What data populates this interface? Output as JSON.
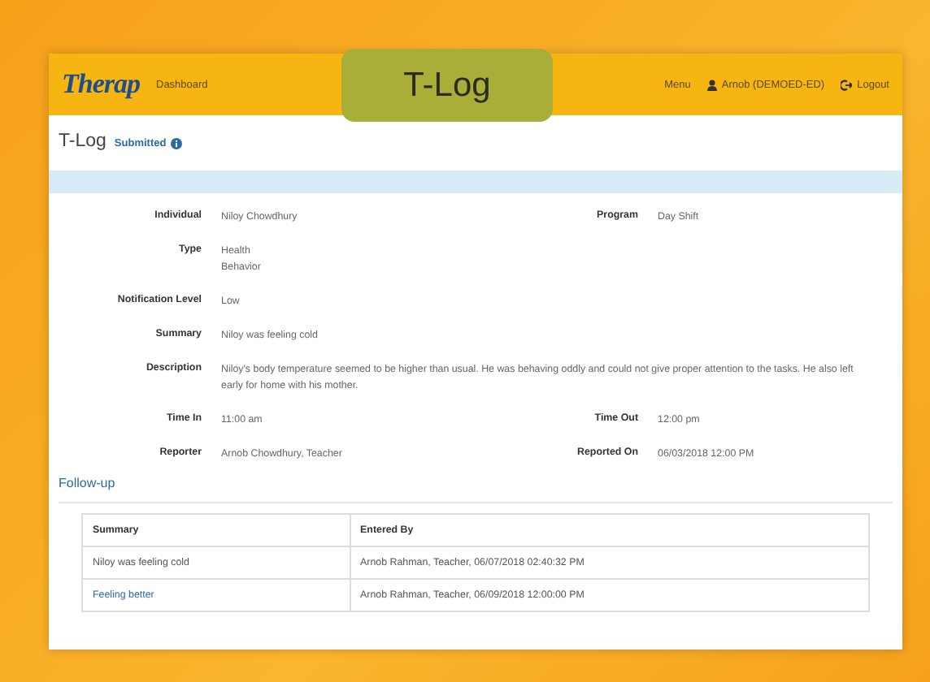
{
  "header": {
    "logo": "Therap",
    "dashboard": "Dashboard",
    "menu": "Menu",
    "user": "Arnob (DEMOED-ED)",
    "logout": "Logout"
  },
  "callout": "T-Log",
  "page": {
    "title": "T-Log",
    "status": "Submitted"
  },
  "rows": [
    [
      {
        "label": "Individual",
        "values": [
          "Niloy Chowdhury"
        ]
      },
      {
        "label": "Program",
        "values": [
          "Day Shift"
        ]
      }
    ],
    [
      {
        "label": "Type",
        "values": [
          "Health",
          "Behavior"
        ]
      }
    ],
    [
      {
        "label": "Notification Level",
        "values": [
          "Low"
        ]
      }
    ],
    [
      {
        "label": "Summary",
        "values": [
          "Niloy was feeling cold"
        ]
      }
    ],
    [
      {
        "label": "Description",
        "values": [
          "Niloy's body temperature seemed to be higher than usual. He was behaving oddly and could not give proper attention to the tasks. He also left early for home with his mother."
        ]
      }
    ],
    [
      {
        "label": "Time In",
        "values": [
          "11:00 am"
        ]
      },
      {
        "label": "Time Out",
        "values": [
          "12:00 pm"
        ]
      }
    ],
    [
      {
        "label": "Reporter",
        "values": [
          "Arnob Chowdhury, Teacher"
        ]
      },
      {
        "label": "Reported On",
        "values": [
          "06/03/2018 12:00 PM"
        ]
      }
    ]
  ],
  "followup": {
    "heading": "Follow-up",
    "columns": [
      "Summary",
      "Entered By"
    ],
    "rows": [
      {
        "kind": "text",
        "cells": [
          "Niloy was feeling cold",
          "Arnob Rahman, Teacher, 06/07/2018 02:40:32 PM"
        ]
      },
      {
        "kind": "link",
        "cells": [
          "Feeling better",
          "Arnob Rahman, Teacher, 06/09/2018 12:00:00 PM"
        ]
      }
    ]
  }
}
